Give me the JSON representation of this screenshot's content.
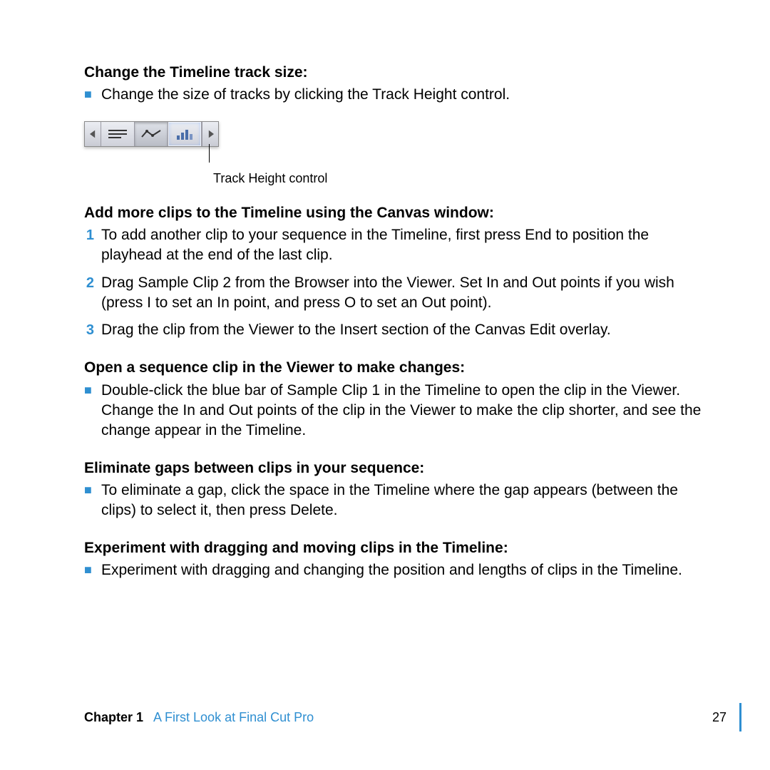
{
  "section1": {
    "heading": "Change the Timeline track size:",
    "bullet": "Change the size of tracks by clicking the Track Height control."
  },
  "callout": "Track Height control",
  "section2": {
    "heading": "Add more clips to the Timeline using the Canvas window:",
    "step1_num": "1",
    "step1": "To add another clip to your sequence in the Timeline, first press End to position the playhead at the end of the last clip.",
    "step2_num": "2",
    "step2": "Drag Sample Clip 2 from the Browser into the Viewer. Set In and Out points if you wish (press I to set an In point, and press O to set an Out point).",
    "step3_num": "3",
    "step3": "Drag the clip from the Viewer to the Insert section of the Canvas Edit overlay."
  },
  "section3": {
    "heading": "Open a sequence clip in the Viewer to make changes:",
    "bullet": "Double-click the blue bar of Sample Clip 1 in the Timeline to open the clip in the Viewer. Change the In and Out points of the clip in the Viewer to make the clip shorter, and see the change appear in the Timeline."
  },
  "section4": {
    "heading": "Eliminate gaps between clips in your sequence:",
    "bullet": "To eliminate a gap, click the space in the Timeline where the gap appears (between the clips) to select it, then press Delete."
  },
  "section5": {
    "heading": "Experiment with dragging and moving clips in the Timeline:",
    "bullet": "Experiment with dragging and changing the position and lengths of clips in the Timeline."
  },
  "footer": {
    "chapter_label": "Chapter 1",
    "chapter_title": "A First Look at Final Cut Pro",
    "page_number": "27"
  },
  "bullet_char": "■"
}
